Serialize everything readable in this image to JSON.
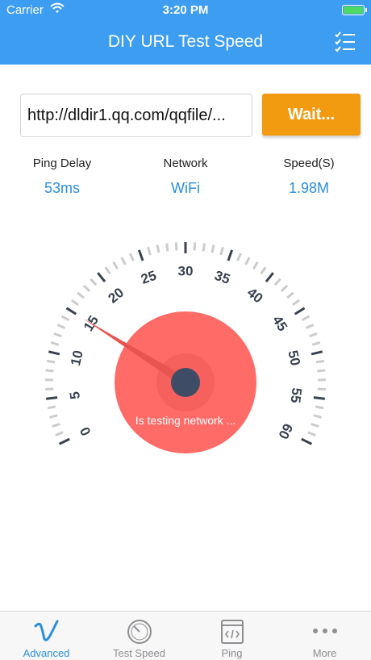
{
  "status_bar": {
    "carrier": "Carrier",
    "time": "3:20 PM"
  },
  "nav": {
    "title": "DIY URL Test Speed"
  },
  "url_input": {
    "value": "http://dldir1.qq.com/qqfile/..."
  },
  "wait_button": {
    "label": "Wait..."
  },
  "stats": {
    "ping": {
      "label": "Ping Delay",
      "value": "53ms"
    },
    "network": {
      "label": "Network",
      "value": "WiFi"
    },
    "speed": {
      "label": "Speed(S)",
      "value": "1.98M"
    }
  },
  "gauge": {
    "tick_labels": [
      "0",
      "5",
      "10",
      "15",
      "20",
      "25",
      "30",
      "35",
      "40",
      "45",
      "50",
      "55",
      "60"
    ],
    "needle_value": 15,
    "status_text": "Is testing network ...",
    "colors": {
      "dial": "#ff6b66",
      "hub": "#3e4c66",
      "needle": "#e85550",
      "ticks": "#3a4250",
      "minor_ticks": "#cccccc"
    }
  },
  "tabs": [
    {
      "label": "Advanced",
      "icon": "vimeo-icon",
      "active": true
    },
    {
      "label": "Test Speed",
      "icon": "speedometer-icon",
      "active": false
    },
    {
      "label": "Ping",
      "icon": "code-window-icon",
      "active": false
    },
    {
      "label": "More",
      "icon": "more-dots-icon",
      "active": false
    }
  ],
  "colors": {
    "accent": "#3d9df0",
    "button": "#f29a10",
    "value_text": "#2b8fdd"
  }
}
